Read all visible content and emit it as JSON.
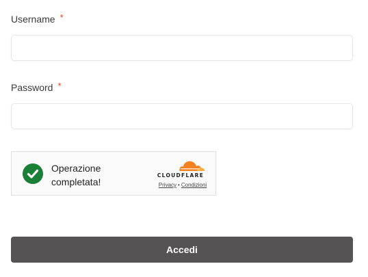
{
  "form": {
    "username": {
      "label": "Username",
      "required_marker": "*",
      "value": "",
      "placeholder": ""
    },
    "password": {
      "label": "Password",
      "required_marker": "*",
      "value": "",
      "placeholder": ""
    },
    "captcha": {
      "status_text": "Operazione completata!",
      "brand": "CLOUDFLARE",
      "privacy_link": "Privacy",
      "separator": "•",
      "terms_link": "Condizioni",
      "status_icon": "check-circle-icon",
      "success_color": "#1a7f37",
      "brand_color": "#f48120"
    },
    "submit_label": "Accedi",
    "submit_color": "#555353",
    "required_color": "#e2401c"
  }
}
